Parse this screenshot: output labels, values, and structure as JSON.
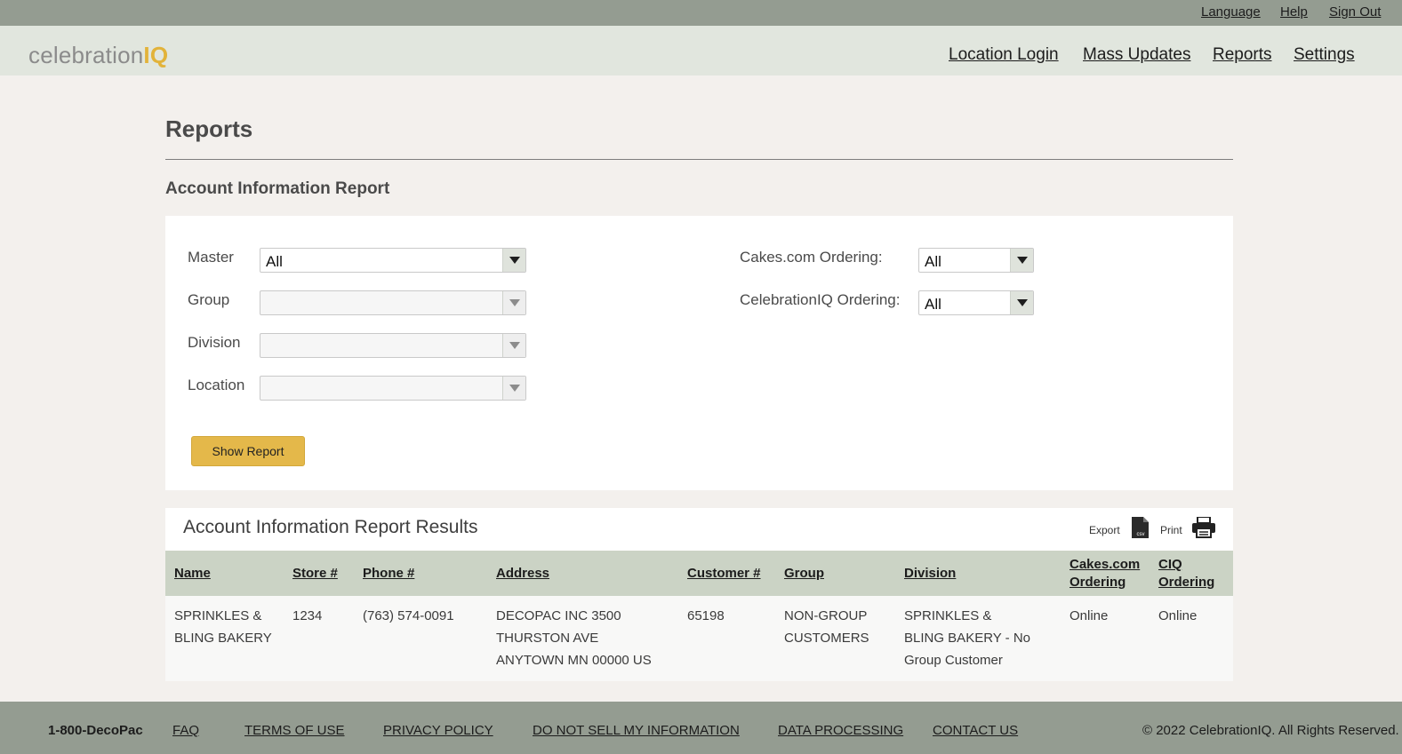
{
  "topbar": {
    "language": "Language",
    "help": "Help",
    "sign_out": "Sign Out"
  },
  "header": {
    "logo_text": "celebration",
    "logo_accent": "IQ",
    "nav": [
      "Location Login",
      "Mass Updates",
      "Reports",
      "Settings"
    ]
  },
  "page": {
    "title": "Reports",
    "report_title": "Account Information Report"
  },
  "filters": {
    "master": {
      "label": "Master",
      "value": "All"
    },
    "group": {
      "label": "Group",
      "value": ""
    },
    "division": {
      "label": "Division",
      "value": ""
    },
    "location": {
      "label": "Location",
      "value": ""
    },
    "cakes_ordering": {
      "label": "Cakes.com Ordering:",
      "value": "All"
    },
    "ciq_ordering": {
      "label": "CelebrationIQ Ordering:",
      "value": "All"
    },
    "show_report": "Show Report"
  },
  "results": {
    "title": "Account Information Report Results",
    "export_label": "Export",
    "print_label": "Print",
    "csv_icon_text": "csv",
    "columns": [
      "Name",
      "Store #",
      "Phone #",
      "Address",
      "Customer #",
      "Group",
      "Division",
      "Cakes.com Ordering",
      "CIQ Ordering"
    ],
    "rows": [
      {
        "name": "SPRINKLES & BLING BAKERY",
        "store": "1234",
        "phone": "(763) 574-0091",
        "address": "DECOPAC INC 3500 THURSTON AVE ANYTOWN MN 00000 US",
        "customer": "65198",
        "group": "NON-GROUP CUSTOMERS",
        "division": "SPRINKLES & BLING BAKERY - No Group Customer",
        "cakes_ordering": "Online",
        "ciq_ordering": "Online"
      }
    ]
  },
  "footer": {
    "phone": "1-800-DecoPac",
    "links": [
      "FAQ",
      "TERMS OF USE",
      "PRIVACY POLICY",
      "DO NOT SELL MY INFORMATION",
      "DATA PROCESSING",
      "CONTACT US"
    ],
    "copyright": "© 2022 CelebrationIQ. All Rights Reserved."
  },
  "colors": {
    "accent": "#e4b84a",
    "topbar": "#949c91",
    "header": "#e1e6de",
    "table_header": "#cbd3c5"
  }
}
